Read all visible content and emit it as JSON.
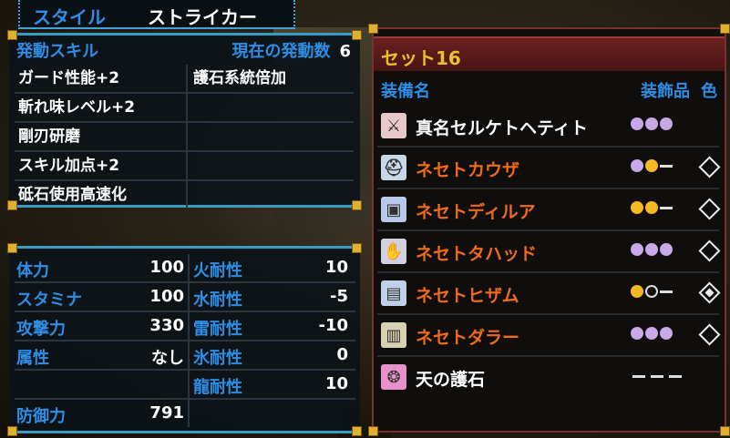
{
  "style_tab": {
    "label": "スタイル",
    "value": "ストライカー"
  },
  "skills": {
    "header_label": "発動スキル",
    "count_label": "現在の発動数",
    "count": "6",
    "rows": [
      {
        "left": "ガード性能+2",
        "right": "護石系統倍加"
      },
      {
        "left": "斬れ味レベル+2",
        "right": ""
      },
      {
        "left": "剛刃研磨",
        "right": ""
      },
      {
        "left": "スキル加点+2",
        "right": ""
      },
      {
        "left": "砥石使用高速化",
        "right": ""
      }
    ]
  },
  "stats": {
    "rows": [
      {
        "name": "体力",
        "value": "100",
        "res_name": "火耐性",
        "res_value": "10"
      },
      {
        "name": "スタミナ",
        "value": "100",
        "res_name": "水耐性",
        "res_value": "-5"
      },
      {
        "name": "攻撃力",
        "value": "330",
        "res_name": "雷耐性",
        "res_value": "-10"
      },
      {
        "name": "属性",
        "value": "なし",
        "res_name": "氷耐性",
        "res_value": "0"
      },
      {
        "name": "",
        "value": "",
        "res_name": "龍耐性",
        "res_value": "10"
      },
      {
        "name": "防御力",
        "value": "791",
        "res_name": "",
        "res_value": ""
      }
    ]
  },
  "equip_set": {
    "title": "セット16",
    "col_name": "装備名",
    "col_deco": "装飾品",
    "col_color": "色",
    "items": [
      {
        "name": "真名セルケトヘティト",
        "icon": "weapon-icon",
        "name_color": "white",
        "slots": [
          "purple",
          "purple",
          "purple"
        ],
        "diamond": "none"
      },
      {
        "name": "ネセトカウザ",
        "icon": "helmet-icon",
        "name_color": "orange",
        "slots": [
          "purple",
          "gold",
          "dash"
        ],
        "diamond": "outline"
      },
      {
        "name": "ネセトディルア",
        "icon": "chest-icon",
        "name_color": "orange",
        "slots": [
          "gold",
          "gold",
          "dash"
        ],
        "diamond": "outline"
      },
      {
        "name": "ネセトタハッド",
        "icon": "arms-icon",
        "name_color": "orange",
        "slots": [
          "purple",
          "purple",
          "purple"
        ],
        "diamond": "outline"
      },
      {
        "name": "ネセトヒザム",
        "icon": "waist-icon",
        "name_color": "orange",
        "slots": [
          "gold",
          "empty",
          "dash"
        ],
        "diamond": "filled"
      },
      {
        "name": "ネセトダラー",
        "icon": "legs-icon",
        "name_color": "orange",
        "slots": [
          "purple",
          "purple",
          "purple"
        ],
        "diamond": "outline"
      },
      {
        "name": "天の護石",
        "icon": "talisman-icon",
        "name_color": "white",
        "slots": [
          "dash3"
        ],
        "diamond": "none"
      }
    ]
  }
}
